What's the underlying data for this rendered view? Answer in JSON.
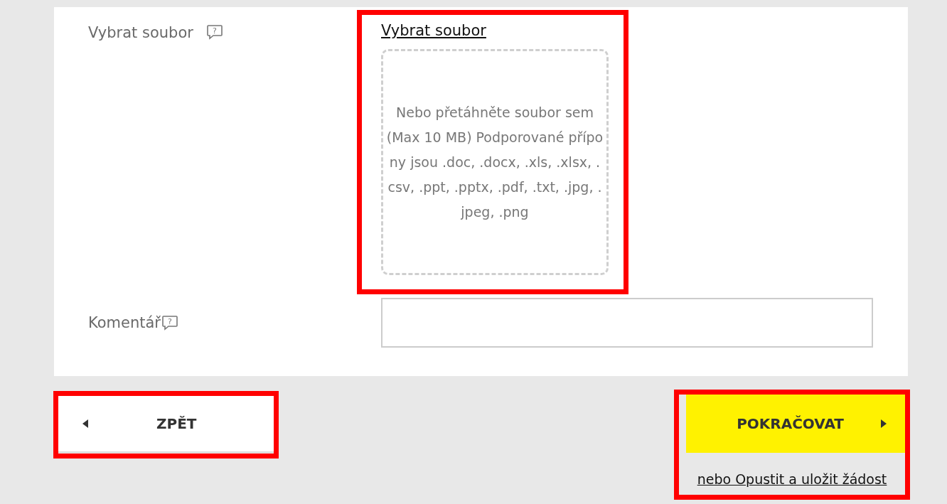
{
  "fields": [
    {
      "kind": "upload",
      "label": "Vybrat soubor",
      "help_glyph": "?",
      "highlighted": true,
      "link": "Vybrat soubor",
      "dropzone_text": "Nebo přetáhněte soubor sem (Max 10 MB) Podporované přípony jsou .doc, .docx, .xls, .xlsx, .csv, .ppt, .pptx, .pdf, .txt, .jpg, .jpeg, .png"
    },
    {
      "kind": "textarea",
      "label": "Komentář",
      "help_glyph": "?",
      "highlighted": false
    }
  ],
  "back_button": {
    "label": "ZPĚT",
    "highlighted": true
  },
  "continue_button": {
    "label": "POKRAČOVAT",
    "highlighted": true
  },
  "save_link": "nebo Opustit a uložit žádost"
}
